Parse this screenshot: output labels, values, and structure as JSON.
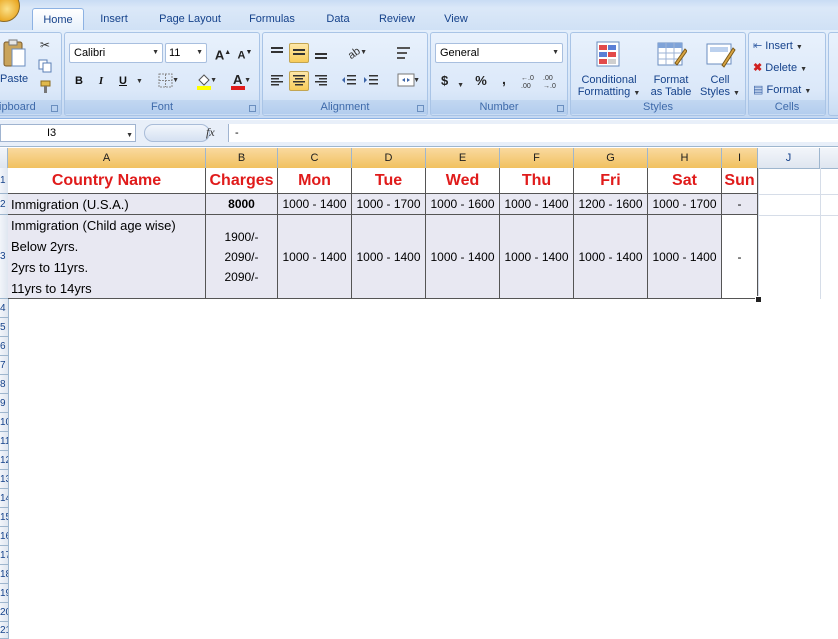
{
  "ribbon": {
    "tabs": [
      "Home",
      "Insert",
      "Page Layout",
      "Formulas",
      "Data",
      "Review",
      "View"
    ],
    "clipboard": {
      "paste_label": "Paste",
      "group_label": "ipboard"
    },
    "font": {
      "name": "Calibri",
      "size": "11",
      "group_label": "Font",
      "bold": "B",
      "italic": "I",
      "underline": "U",
      "grow": "A",
      "shrink": "A",
      "fill_color": "#ffff00",
      "font_color": "#e01b1b"
    },
    "alignment": {
      "group_label": "Alignment"
    },
    "number": {
      "format": "General",
      "group_label": "Number",
      "currency": "$",
      "percent": "%",
      "comma": ","
    },
    "styles": {
      "group_label": "Styles",
      "conditional_line1": "Conditional",
      "conditional_line2": "Formatting",
      "format_table_line1": "Format",
      "format_table_line2": "as Table",
      "cell_styles_line1": "Cell",
      "cell_styles_line2": "Styles"
    },
    "cells": {
      "group_label": "Cells",
      "insert": "Insert",
      "delete": "Delete",
      "format": "Format"
    }
  },
  "formula_bar": {
    "name_box": "I3",
    "fx": "fx",
    "value": "-"
  },
  "sheet": {
    "columns": [
      "A",
      "B",
      "C",
      "D",
      "E",
      "F",
      "G",
      "H",
      "I",
      "J"
    ],
    "rows": [
      "1",
      "2",
      "3",
      "4",
      "5",
      "6",
      "7",
      "8",
      "9",
      "10",
      "11",
      "12",
      "13",
      "14",
      "15",
      "16",
      "17",
      "18",
      "19",
      "20",
      "21",
      "22"
    ],
    "headers": [
      "Country Name",
      "Charges",
      "Mon",
      "Tue",
      "Wed",
      "Thu",
      "Fri",
      "Sat",
      "Sun"
    ],
    "row1": {
      "name": "Immigration (U.S.A.)",
      "charges": "8000",
      "days": [
        "1000 - 1400",
        "1000 - 1700",
        "1000 - 1600",
        "1000 - 1400",
        "1200 - 1600",
        "1000 - 1700",
        "-"
      ]
    },
    "row2": {
      "name_lines": [
        "Immigration (Child age wise)",
        "Below 2yrs.",
        "2yrs to 11yrs.",
        "11yrs to 14yrs"
      ],
      "charges_lines": [
        "1900/-",
        "2090/-",
        "2090/-"
      ],
      "days": [
        "1000 - 1400",
        "1000 - 1400",
        "1000 - 1400",
        "1000 - 1400",
        "1000 - 1400",
        "1000 - 1400",
        "-"
      ]
    }
  },
  "colors": {
    "header_text": "#e01b1b",
    "data_fill": "#e8e8f2",
    "selected_col": "#f6cf82"
  }
}
